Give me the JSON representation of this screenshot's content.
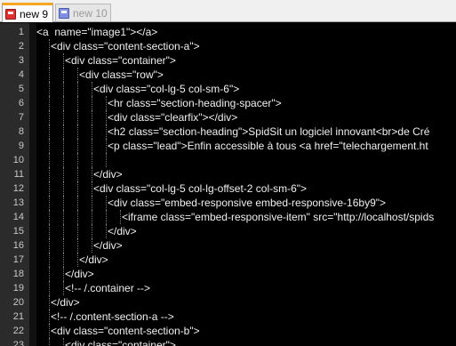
{
  "tabs": [
    {
      "label": "new  9",
      "active": true
    },
    {
      "label": "new  10",
      "active": false
    }
  ],
  "editor": {
    "lines": [
      {
        "n": "1",
        "indent": 0,
        "text": "<a  name=\"image1\"></a>"
      },
      {
        "n": "2",
        "indent": 1,
        "text": "<div class=\"content-section-a\">"
      },
      {
        "n": "3",
        "indent": 2,
        "text": "<div class=\"container\">"
      },
      {
        "n": "4",
        "indent": 3,
        "text": "<div class=\"row\">"
      },
      {
        "n": "5",
        "indent": 4,
        "text": "<div class=\"col-lg-5 col-sm-6\">"
      },
      {
        "n": "6",
        "indent": 5,
        "text": "<hr class=\"section-heading-spacer\">"
      },
      {
        "n": "7",
        "indent": 5,
        "text": "<div class=\"clearfix\"></div>"
      },
      {
        "n": "8",
        "indent": 5,
        "text": "<h2 class=\"section-heading\">SpidSit un logiciel innovant<br>de Cré"
      },
      {
        "n": "9",
        "indent": 5,
        "text": "<p class=\"lead\">Enfin accessible à tous <a href=\"telechargement.ht"
      },
      {
        "n": "10",
        "indent": 5,
        "text": ""
      },
      {
        "n": "11",
        "indent": 4,
        "text": "</div>"
      },
      {
        "n": "12",
        "indent": 4,
        "text": "<div class=\"col-lg-5 col-lg-offset-2 col-sm-6\">"
      },
      {
        "n": "13",
        "indent": 5,
        "text": "<div class=\"embed-responsive embed-responsive-16by9\">"
      },
      {
        "n": "14",
        "indent": 6,
        "text": "<iframe class=\"embed-responsive-item\" src=\"http://localhost/spids"
      },
      {
        "n": "15",
        "indent": 5,
        "text": "</div>"
      },
      {
        "n": "16",
        "indent": 4,
        "text": "</div>"
      },
      {
        "n": "17",
        "indent": 3,
        "text": "</div>"
      },
      {
        "n": "18",
        "indent": 2,
        "text": "</div>"
      },
      {
        "n": "19",
        "indent": 2,
        "text": "<!-- /.container -->"
      },
      {
        "n": "20",
        "indent": 1,
        "text": "</div>"
      },
      {
        "n": "21",
        "indent": 1,
        "text": "<!-- /.content-section-a -->"
      },
      {
        "n": "22",
        "indent": 1,
        "text": "<div class=\"content-section-b\">"
      },
      {
        "n": "23",
        "indent": 2,
        "text": "<div class=\"container\">"
      }
    ]
  }
}
